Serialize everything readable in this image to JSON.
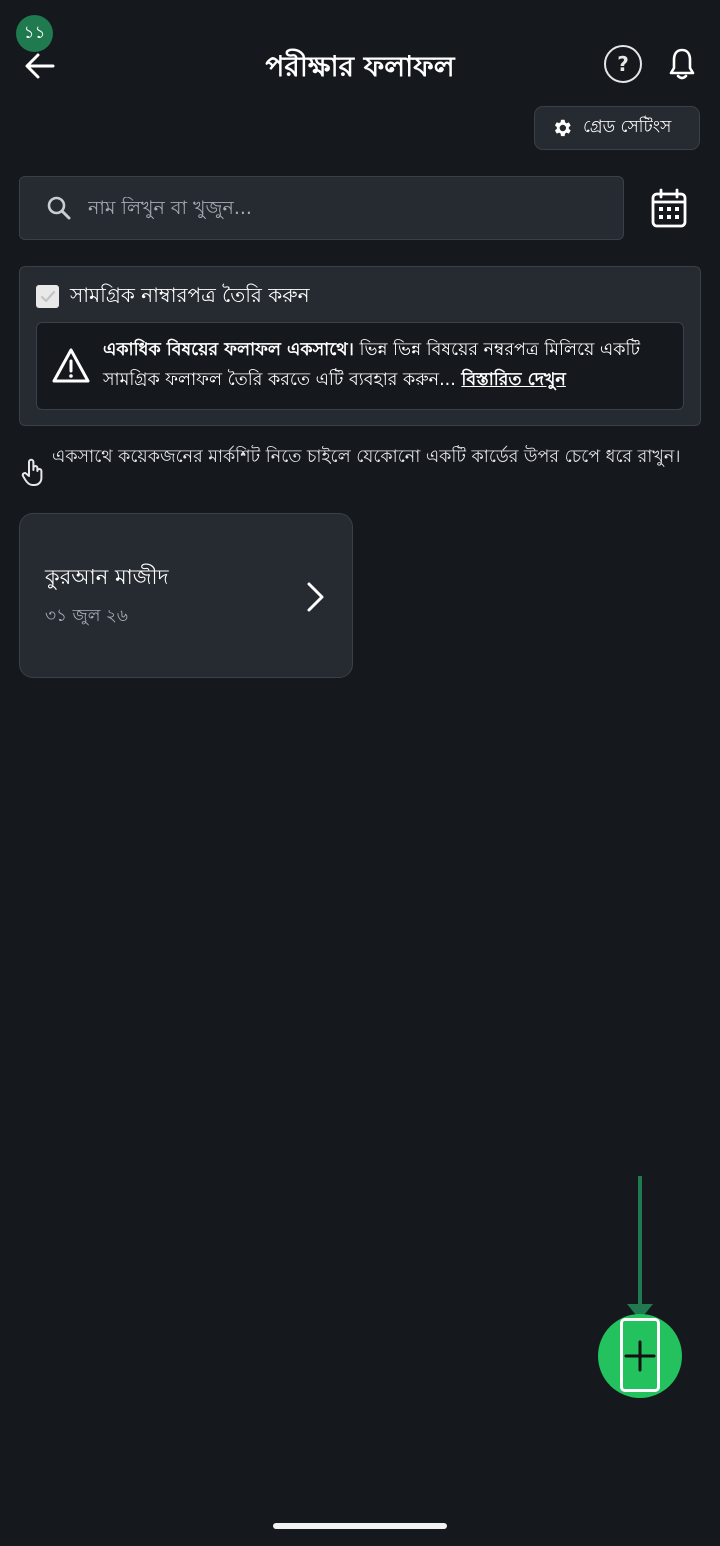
{
  "step_badge": "১১",
  "header": {
    "title": "পরীক্ষার ফলাফল",
    "help_label": "?"
  },
  "grade_settings": {
    "label": "গ্রেড সেটিংস"
  },
  "search": {
    "placeholder": "নাম লিখুন বা খুজুন..."
  },
  "consolidated": {
    "checkbox_label": "সামগ্রিক নাম্বারপত্র তৈরি করুন",
    "checked": true,
    "info_bold": "একাধিক বিষয়ের ফলাফল একসাথে।",
    "info_text": " ভিন্ন ভিন্ন বিষয়ের নম্বরপত্র মিলিয়ে একটি সামগ্রিক ফলাফল তৈরি করতে এটি ব্যবহার করুন... ",
    "info_link": "বিস্তারিত দেখুন"
  },
  "hint": {
    "text": "একসাথে কয়েকজনের মার্কশিট নিতে চাইলে যেকোনো একটি কার্ডের উপর চেপে ধরে রাখুন।"
  },
  "exams": [
    {
      "title": "কুরআন মাজীদ",
      "date": "৩১ জুল ২৬"
    }
  ],
  "colors": {
    "background": "#15181c",
    "surface": "#262a31",
    "accent": "#24c25e",
    "badge": "#1f7a4f"
  },
  "icons": [
    "back-arrow-icon",
    "help-icon",
    "bell-icon",
    "gear-icon",
    "search-icon",
    "calendar-icon",
    "check-icon",
    "warning-icon",
    "tap-hand-icon",
    "chevron-right-icon",
    "plus-icon"
  ]
}
